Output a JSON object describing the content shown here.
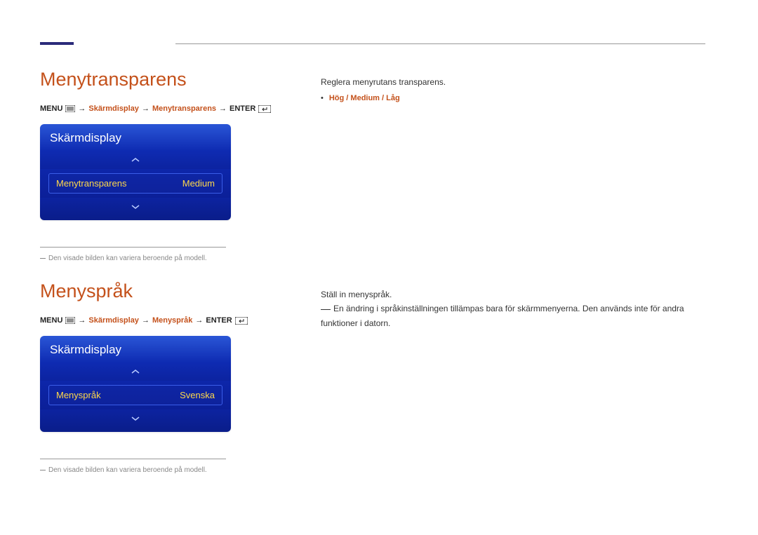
{
  "section1": {
    "heading": "Menytransparens",
    "breadcrumb": {
      "menu": "MENU",
      "a": "Skärmdisplay",
      "b": "Menytransparens",
      "enter": "ENTER"
    },
    "osd": {
      "title": "Skärmdisplay",
      "item_label": "Menytransparens",
      "item_value": "Medium"
    },
    "note": "Den visade bilden kan variera beroende på modell.",
    "desc": "Reglera menyrutans transparens.",
    "options": "Hög / Medium / Låg"
  },
  "section2": {
    "heading": "Menyspråk",
    "breadcrumb": {
      "menu": "MENU",
      "a": "Skärmdisplay",
      "b": "Menyspråk",
      "enter": "ENTER"
    },
    "osd": {
      "title": "Skärmdisplay",
      "item_label": "Menyspråk",
      "item_value": "Svenska"
    },
    "note": "Den visade bilden kan variera beroende på modell.",
    "desc": "Ställ in menyspråk.",
    "desc2": "En ändring i språkinställningen tillämpas bara för skärmmenyerna. Den används inte för andra funktioner i datorn."
  }
}
